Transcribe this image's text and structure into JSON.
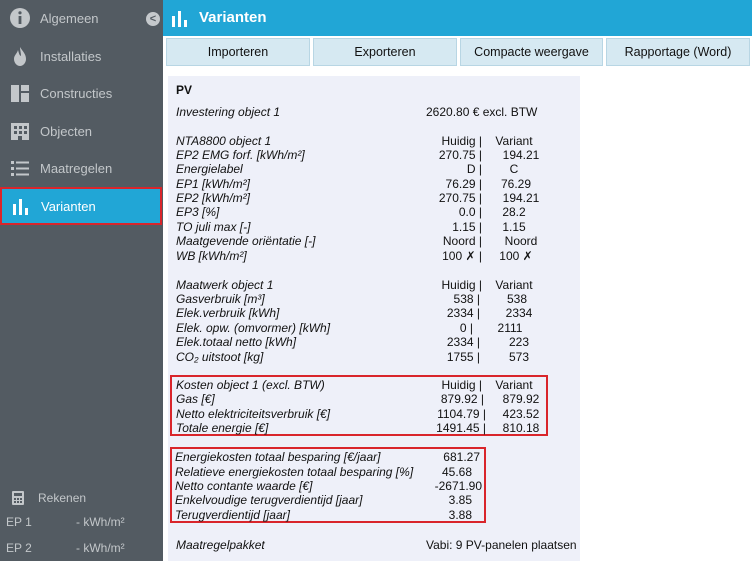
{
  "sidebar": {
    "items": [
      {
        "label": "Algemeen",
        "icon": "info-icon"
      },
      {
        "label": "Installaties",
        "icon": "flame-icon"
      },
      {
        "label": "Constructies",
        "icon": "blocks-icon"
      },
      {
        "label": "Objecten",
        "icon": "building-icon"
      },
      {
        "label": "Maatregelen",
        "icon": "list-icon"
      },
      {
        "label": "Varianten",
        "icon": "bar-chart-icon",
        "active": true
      }
    ],
    "collapse_glyph": "<",
    "rekenen_label": "Rekenen",
    "ep1_label": "EP 1",
    "ep1_value": "-  kWh/m²",
    "ep2_label": "EP 2",
    "ep2_value": "-  kWh/m²"
  },
  "header": {
    "title": "Varianten"
  },
  "toolbar": {
    "import_label": "Importeren",
    "export_label": "Exporteren",
    "compact_label": "Compacte weergave",
    "report_label": "Rapportage (Word)"
  },
  "panel": {
    "heading": "PV",
    "investment": {
      "label": "Investering object 1",
      "value": "2620.80 € excl. BTW"
    },
    "nta": {
      "title": "NTA8800 object 1",
      "col_current": "Huidig |",
      "col_variant": "Variant",
      "rows": [
        {
          "label": "EP2 EMG forf. [kWh/m²]",
          "current": "270.75 |",
          "variant": "194.21"
        },
        {
          "label": "Energielabel",
          "current": "D |",
          "variant": "C"
        },
        {
          "label": "EP1 [kWh/m²]",
          "current": "76.29 |",
          "variant": "76.29"
        },
        {
          "label": "EP2 [kWh/m²]",
          "current": "270.75 |",
          "variant": "194.21"
        },
        {
          "label": "EP3 [%]",
          "current": "0.0 |",
          "variant": "28.2"
        },
        {
          "label": "TO juli max [-]",
          "current": "1.15 |",
          "variant": "1.15"
        },
        {
          "label": "Maatgevende oriëntatie [-]",
          "current": "Noord |",
          "variant": "Noord"
        },
        {
          "label": "WB [kWh/m²]",
          "current": "100 ✗ |",
          "variant": "100 ✗"
        }
      ]
    },
    "maatwerk": {
      "title": "Maatwerk object 1",
      "col_current": "Huidig |",
      "col_variant": "Variant",
      "rows": [
        {
          "label": "Gasverbruik [m³]",
          "current": "538 |",
          "variant": "538"
        },
        {
          "label": "Elek.verbruik [kWh]",
          "current": "2334 |",
          "variant": "2334"
        },
        {
          "label": "Elek. opw. (omvormer) [kWh]",
          "current": "0 |",
          "variant": "2111"
        },
        {
          "label": "Elek.totaal netto [kWh]",
          "current": "2334 |",
          "variant": "223"
        },
        {
          "label": "CO₂ uitstoot [kg]",
          "current": "1755 |",
          "variant": "573"
        }
      ]
    },
    "kosten": {
      "title": "Kosten object 1 (excl. BTW)",
      "col_current": "Huidig |",
      "col_variant": "Variant",
      "rows": [
        {
          "label": "Gas [€]",
          "current": "879.92 |",
          "variant": "879.92"
        },
        {
          "label": "Netto elektriciteitsverbruik [€]",
          "current": "1104.79 |",
          "variant": "423.52"
        },
        {
          "label": "Totale energie [€]",
          "current": "1491.45 |",
          "variant": "810.18"
        }
      ]
    },
    "besparing": {
      "rows": [
        {
          "label": "Energiekosten totaal besparing [€/jaar]",
          "value": "681.27"
        },
        {
          "label": "Relatieve energiekosten totaal besparing [%]",
          "value": "45.68"
        },
        {
          "label": "Netto contante waarde [€]",
          "value": "-2671.90"
        },
        {
          "label": "Enkelvoudige terugverdientijd [jaar]",
          "value": "3.85"
        },
        {
          "label": "Terugverdientijd [jaar]",
          "value": "3.88"
        }
      ]
    },
    "pakket": {
      "label": "Maatregelpakket",
      "value": "Vabi: 9 PV-panelen plaatsen"
    }
  },
  "colors": {
    "accent": "#21a6d6",
    "sidebar": "#535b62",
    "highlight": "#d9252b",
    "panel": "#eef0f9"
  }
}
